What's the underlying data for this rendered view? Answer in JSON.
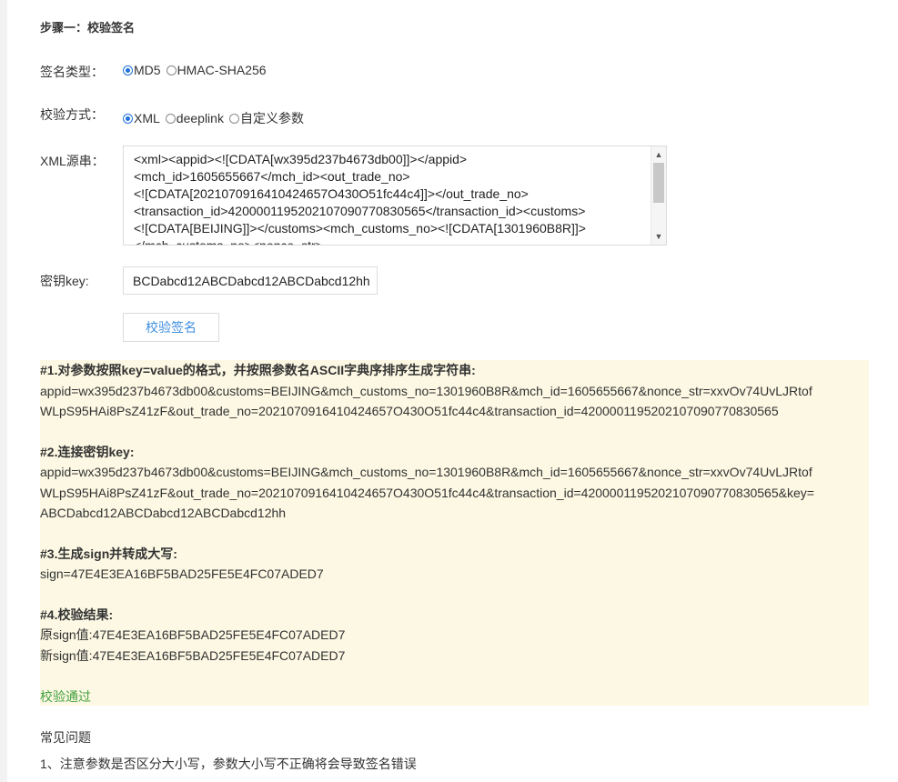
{
  "step_title": "步骤一：校验签名",
  "sign_type": {
    "label": "签名类型：",
    "options": [
      {
        "label": "MD5",
        "selected": true
      },
      {
        "label": "HMAC-SHA256",
        "selected": false
      }
    ]
  },
  "verify_method": {
    "label": "校验方式：",
    "options": [
      {
        "label": "XML",
        "selected": true
      },
      {
        "label": "deeplink",
        "selected": false
      },
      {
        "label": "自定义参数",
        "selected": false
      }
    ]
  },
  "xml_source": {
    "label": "XML源串：",
    "value": "<xml><appid><![CDATA[wx395d237b4673db00]]></appid>\n<mch_id>1605655667</mch_id><out_trade_no>\n<![CDATA[2021070916410424657O430O51fc44c4]]></out_trade_no>\n<transaction_id>4200001195202107090770830565</transaction_id><customs>\n<![CDATA[BEIJING]]></customs><mch_customs_no><![CDATA[1301960B8R]]>\n</mch_customs_no><nonce_str>"
  },
  "key": {
    "label": "密钥key:",
    "value": "BCDabcd12ABCDabcd12ABCDabcd12hh"
  },
  "verify_button_label": "校验签名",
  "result": {
    "step1_title": "#1.对参数按照key=value的格式，并按照参数名ASCII字典序排序生成字符串:",
    "step1_line1": "appid=wx395d237b4673db00&customs=BEIJING&mch_customs_no=1301960B8R&mch_id=1605655667&nonce_str=xxvOv74UvLJRtof",
    "step1_line2": "WLpS95HAi8PsZ41zF&out_trade_no=2021070916410424657O430O51fc44c4&transaction_id=4200001195202107090770830565",
    "step2_title": "#2.连接密钥key:",
    "step2_line1": "appid=wx395d237b4673db00&customs=BEIJING&mch_customs_no=1301960B8R&mch_id=1605655667&nonce_str=xxvOv74UvLJRtof",
    "step2_line2": "WLpS95HAi8PsZ41zF&out_trade_no=2021070916410424657O430O51fc44c4&transaction_id=4200001195202107090770830565&key=",
    "step2_line3": "ABCDabcd12ABCDabcd12ABCDabcd12hh",
    "step3_title": "#3.生成sign并转成大写:",
    "step3_line1": "sign=47E4E3EA16BF5BAD25FE5E4FC07ADED7",
    "step4_title": "#4.校验结果:",
    "step4_line1": "原sign值:47E4E3EA16BF5BAD25FE5E4FC07ADED7",
    "step4_line2": "新sign值:47E4E3EA16BF5BAD25FE5E4FC07ADED7",
    "status": "校验通过"
  },
  "faq": {
    "title": "常见问题",
    "items": [
      "1、注意参数是否区分大小写，参数大小写不正确将会导致签名错误"
    ]
  },
  "colors": {
    "accent": "#1e6fd9",
    "button_text": "#3e8ee0",
    "result_bg": "#fcf8e3",
    "success": "#44a13e"
  }
}
